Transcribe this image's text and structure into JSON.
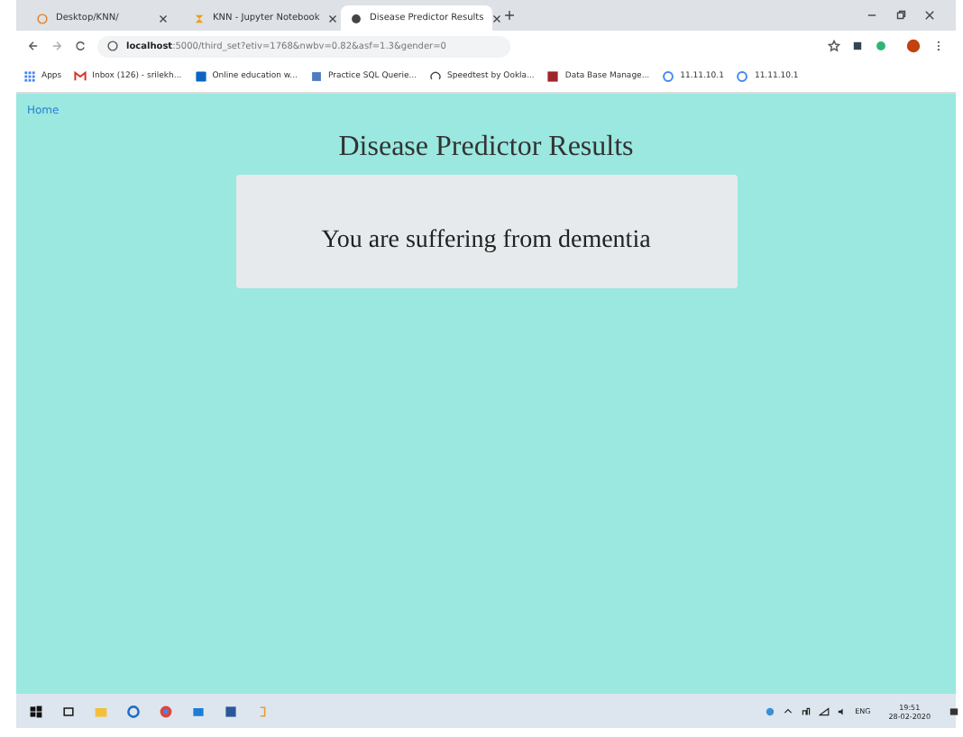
{
  "tabs": [
    {
      "title": "Desktop/KNN/",
      "selected": false
    },
    {
      "title": "KNN - Jupyter Notebook",
      "selected": false
    },
    {
      "title": "Disease Predictor Results",
      "selected": true
    }
  ],
  "address": {
    "url": "**localhost**:5000/third_set?etiv=1768&nwbv=0.82&asf=1.3&gender=0"
  },
  "bookmarks": [
    "Apps",
    "Inbox (126) - srilekh...",
    "Online education w...",
    "Practice SQL Querie...",
    "Speedtest by Ookla...",
    "Data Base Manage...",
    "11.11.10.1",
    "11.11.10.1"
  ],
  "page": {
    "nav_link": "Home",
    "heading": "Disease Predictor Results",
    "result": "You are suffering from dementia"
  },
  "taskbar": {
    "language": "ENG",
    "time": "19:51",
    "date": "28-02-2020"
  }
}
